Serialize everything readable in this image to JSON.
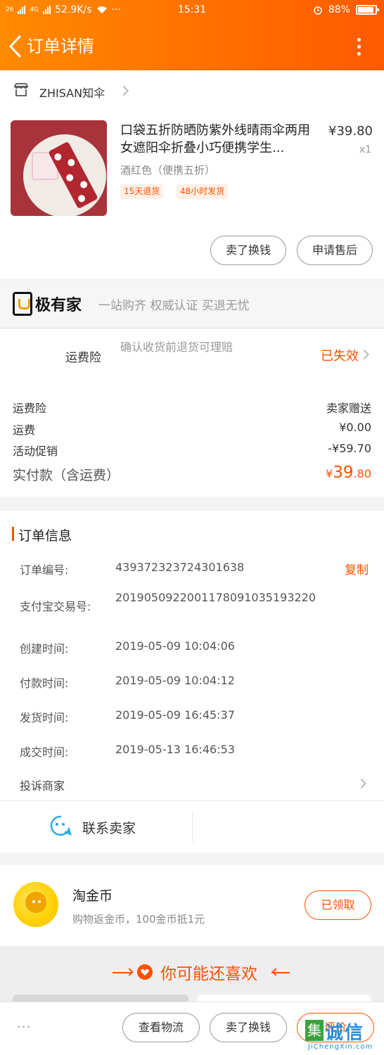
{
  "status_bar": {
    "network": "26",
    "network2": "4G",
    "speed": "52.9K/s",
    "more": "···",
    "time": "15:31",
    "battery": "88%"
  },
  "header": {
    "title": "订单详情"
  },
  "shop": {
    "name": "ZHISAN知伞"
  },
  "product": {
    "name": "口袋五折防晒防紫外线晴雨伞两用女遮阳伞折叠小巧便携学生...",
    "price": "¥39.80",
    "qty": "x1",
    "sku": "酒红色（便携五折）",
    "tags": [
      "15天退货",
      "48小时发货"
    ],
    "actions": [
      "卖了换钱",
      "申请售后"
    ]
  },
  "jiyoujia": {
    "brand": "极有家",
    "slogan": "一站购齐 权威认证 买退无忧"
  },
  "insurance": {
    "label": "运费险",
    "desc": "确认收货前退货可理赔",
    "status": "已失效"
  },
  "costs": [
    {
      "label": "运费险",
      "value": "卖家赠送"
    },
    {
      "label": "运费",
      "value": "¥0.00"
    },
    {
      "label": "活动促销",
      "value": "-¥59.70"
    }
  ],
  "total": {
    "label": "实付款（含运费）",
    "currency": "¥",
    "int": "39",
    "dec": ".80"
  },
  "order_info": {
    "title": "订单信息",
    "copy": "复制",
    "rows": [
      {
        "label": "订单编号:",
        "value": "439372323724301638"
      },
      {
        "label": "支付宝交易号:",
        "value": "2019050922001178091035193220"
      },
      {
        "label": "创建时间:",
        "value": "2019-05-09 10:04:06"
      },
      {
        "label": "付款时间:",
        "value": "2019-05-09 10:04:12"
      },
      {
        "label": "发货时间:",
        "value": "2019-05-09 16:45:37"
      },
      {
        "label": "成交时间:",
        "value": "2019-05-13 16:46:53"
      }
    ],
    "complain": "投诉商家",
    "contact": "联系卖家"
  },
  "gold_coin": {
    "title": "淘金币",
    "desc": "购物返金币，100金币抵1元",
    "button": "已领取"
  },
  "recommend": {
    "title": "你可能还喜欢"
  },
  "bottom_bar": {
    "more": "···",
    "buttons": [
      "查看物流",
      "卖了换钱",
      "评价"
    ]
  },
  "watermark": {
    "char": "集",
    "text": "诚信",
    "url": "JiChengXin.com"
  }
}
